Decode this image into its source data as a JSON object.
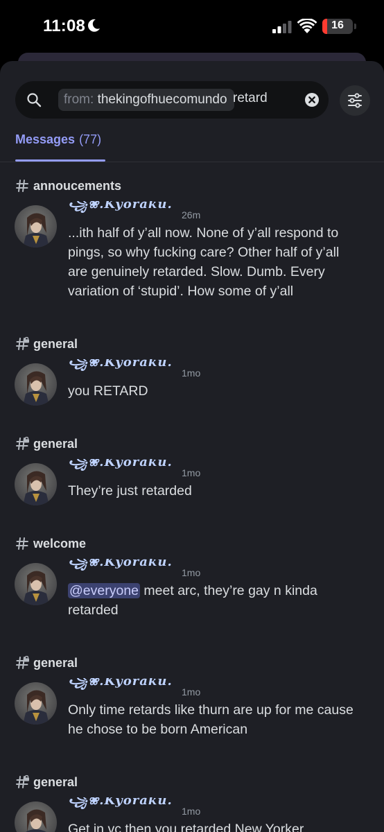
{
  "status_bar": {
    "time": "11:08",
    "battery_level": "16",
    "battery_color": "#ff3b30"
  },
  "search": {
    "filter_prefix": "from:",
    "filter_value": "thekingofhuecomundo",
    "query": "retard",
    "icons": {
      "search": "search-icon",
      "clear": "clear-icon",
      "filter": "filter-sliders-icon"
    }
  },
  "tabs": {
    "messages_label": "Messages",
    "messages_count": "(77)",
    "accent_color": "#949cf7"
  },
  "results": [
    {
      "channel": "annoucements",
      "channel_icon": "hash-icon",
      "author": "꧁❀.Kyoraku.",
      "timestamp": "26m",
      "text": "...ith half of y’all now.  None of y’all respond to pings, so why fucking care?  Other half of y’all are genuinely retarded. Slow. Dumb. Every variation of ‘stupid’. How some of y’all"
    },
    {
      "channel": "general",
      "channel_icon": "hash-lock-icon",
      "author": "꧁❀.Kyoraku.",
      "timestamp": "1mo",
      "text": "you RETARD"
    },
    {
      "channel": "general",
      "channel_icon": "hash-lock-icon",
      "author": "꧁❀.Kyoraku.",
      "timestamp": "1mo",
      "text": "They’re just retarded"
    },
    {
      "channel": "welcome",
      "channel_icon": "hash-icon",
      "author": "꧁❀.Kyoraku.",
      "timestamp": "1mo",
      "mention": "@everyone",
      "text": " meet arc, they’re gay n kinda retarded"
    },
    {
      "channel": "general",
      "channel_icon": "hash-lock-icon",
      "author": "꧁❀.Kyoraku.",
      "timestamp": "1mo",
      "text": "Only time retards like thurn are up for me cause he chose to be born American"
    },
    {
      "channel": "general",
      "channel_icon": "hash-lock-icon",
      "author": "꧁❀.Kyoraku.",
      "timestamp": "1mo",
      "text": "Get in vc then you retarded New Yorker"
    }
  ]
}
